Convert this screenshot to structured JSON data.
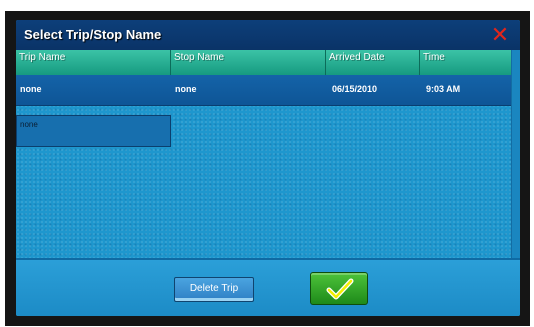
{
  "dialog": {
    "title": "Select Trip/Stop Name",
    "close_icon": "close-icon"
  },
  "table": {
    "columns": [
      "Trip Name",
      "Stop Name",
      "Arrived Date",
      "Time"
    ],
    "rows": [
      [
        "none",
        "none",
        "06/15/2010",
        "9:03 AM"
      ]
    ]
  },
  "list": {
    "items": [
      "none"
    ]
  },
  "footer": {
    "delete_label": "Delete Trip",
    "confirm_icon": "checkmark-icon"
  },
  "colors": {
    "title_bar": "#0d3f7a",
    "header": "#27b293",
    "row": "#1463a8",
    "background": "#1e97ce",
    "close": "#e0261c",
    "confirm": "#2fa028"
  }
}
